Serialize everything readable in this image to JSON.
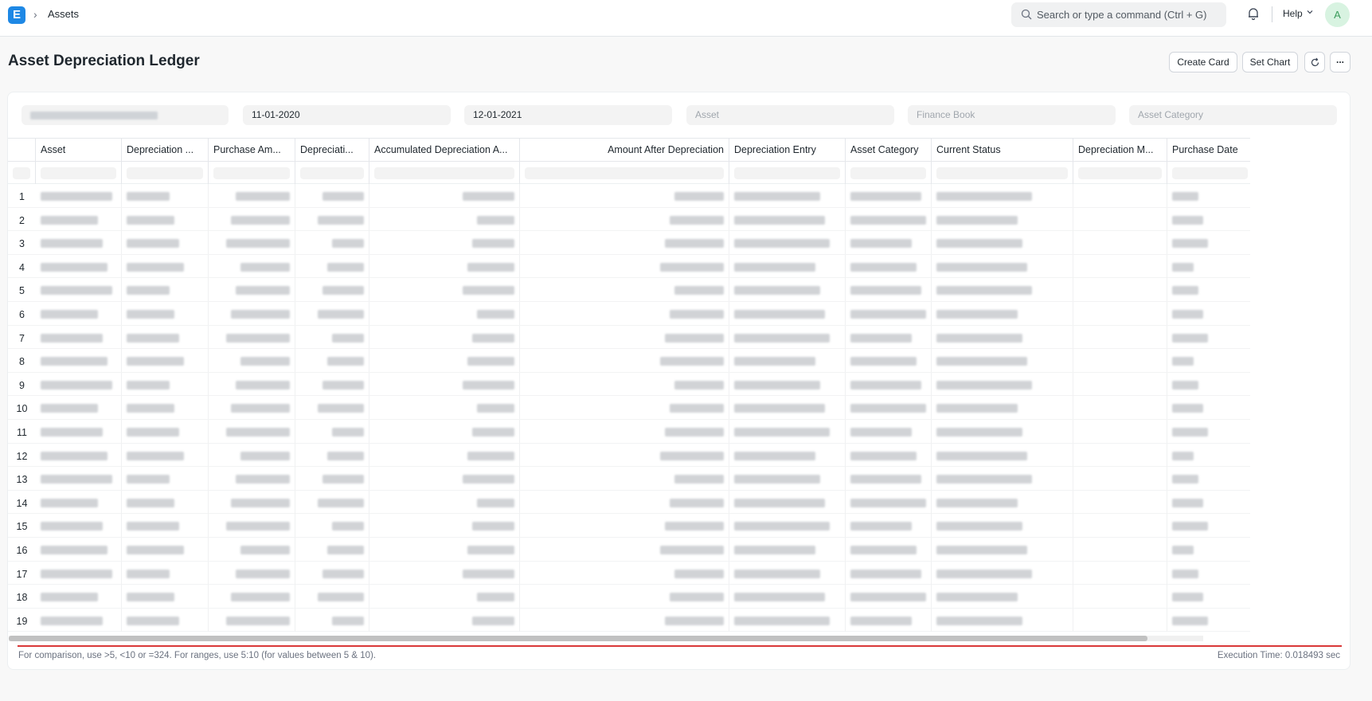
{
  "navbar": {
    "logo_letter": "E",
    "breadcrumb": "Assets",
    "search_placeholder": "Search or type a command (Ctrl + G)",
    "help_label": "Help",
    "avatar_letter": "A"
  },
  "page": {
    "title": "Asset Depreciation Ledger",
    "buttons": {
      "create_card": "Create Card",
      "set_chart": "Set Chart",
      "more": "..."
    }
  },
  "filters": {
    "company": "",
    "from_date": "11-01-2020",
    "to_date": "12-01-2021",
    "asset_placeholder": "Asset",
    "finance_book_placeholder": "Finance Book",
    "asset_category_placeholder": "Asset Category"
  },
  "table": {
    "columns": [
      "Asset",
      "Depreciation ...",
      "Purchase Am...",
      "Depreciati...",
      "Accumulated Depreciation A...",
      "Amount After Depreciation",
      "Depreciation Entry",
      "Asset Category",
      "Current Status",
      "Depreciation M...",
      "Purchase Date"
    ],
    "row_numbers": [
      "1",
      "2",
      "3",
      "4",
      "5",
      "6",
      "7",
      "8",
      "9",
      "10",
      "11",
      "12",
      "13",
      "14",
      "15",
      "16",
      "17",
      "18",
      "19"
    ]
  },
  "footer": {
    "hint": "For comparison, use >5, <10 or =324. For ranges, use 5:10 (for values between 5 & 10).",
    "execution_time": "Execution Time: 0.018493 sec"
  },
  "colors": {
    "accent": "#1e88e5",
    "red_line": "#d93838"
  },
  "icons": [
    "search-icon",
    "bell-icon",
    "chevron-down-icon",
    "refresh-icon",
    "more-icon",
    "chevron-right-icon"
  ]
}
